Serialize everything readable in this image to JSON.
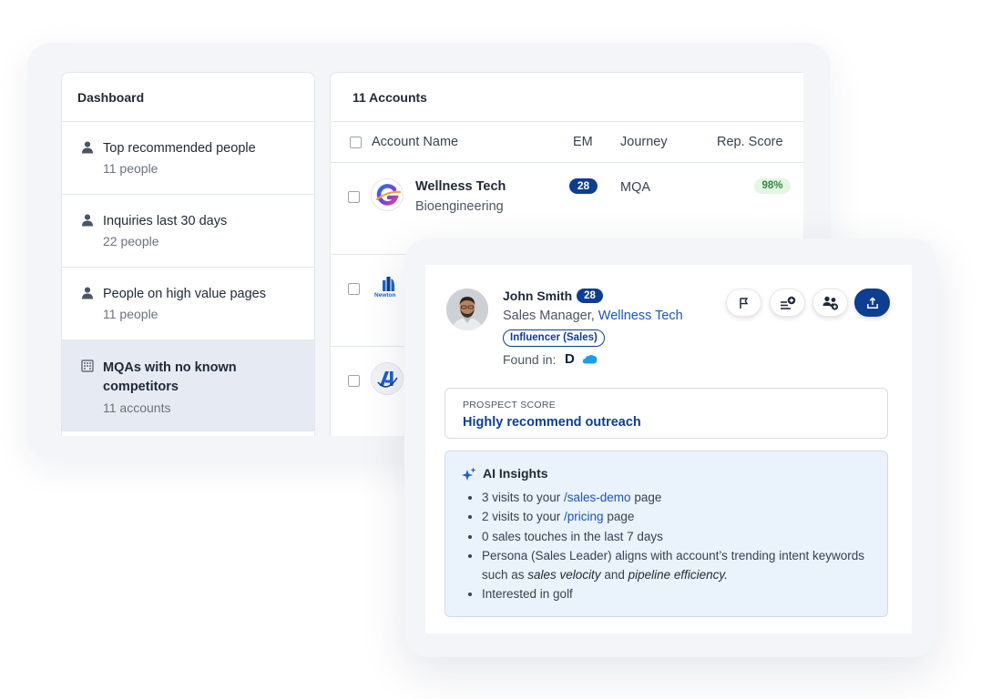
{
  "dashboard": {
    "title": "Dashboard",
    "items": [
      {
        "label": "Top recommended people",
        "count": "11 people",
        "icon": "person-icon"
      },
      {
        "label": "Inquiries last 30 days",
        "count": "22 people",
        "icon": "person-icon"
      },
      {
        "label": "People on high value pages",
        "count": "11 people",
        "icon": "person-icon"
      },
      {
        "label": "MQAs with no known competitors",
        "count": "11 accounts",
        "icon": "building-icon",
        "active": true
      }
    ]
  },
  "accounts": {
    "title": "11 Accounts",
    "columns": {
      "name": "Account Name",
      "em": "EM",
      "journey": "Journey",
      "score": "Rep. Score"
    },
    "rows": [
      {
        "name": "Wellness Tech",
        "industry": "Bioengineering",
        "em": "28",
        "journey": "MQA",
        "score": "98%"
      },
      {
        "logo_text": "Newton"
      },
      {}
    ]
  },
  "person": {
    "name": "John Smith",
    "badge": "28",
    "role": "Sales Manager,",
    "company": "Wellness Tech",
    "tag": "Influencer (Sales)",
    "found_in": "Found in:",
    "found_d": "D"
  },
  "prospect": {
    "label": "PROSPECT SCORE",
    "value": "Highly recommend outreach"
  },
  "insights": {
    "title": "AI Insights",
    "b1_pre": "3 visits to your ",
    "b1_link": "/sales-demo",
    "b1_post": " page",
    "b2_pre": "2 visits to your ",
    "b2_link": "/pricing",
    "b2_post": " page",
    "b3": "0 sales touches in the last 7 days",
    "b4_pre": "Persona (Sales Leader) aligns with account’s trending intent keywords such as ",
    "b4_em1": "sales velocity",
    "b4_mid": " and ",
    "b4_em2": "pipeline efficiency.",
    "b5": "Interested in golf"
  },
  "colors": {
    "brand_navy": "#0d3e8f",
    "link_blue": "#1a56b8",
    "active_row": "#e6ebf3",
    "score_green": "#2f8a3b",
    "ai_bg": "#eaf2fb"
  }
}
